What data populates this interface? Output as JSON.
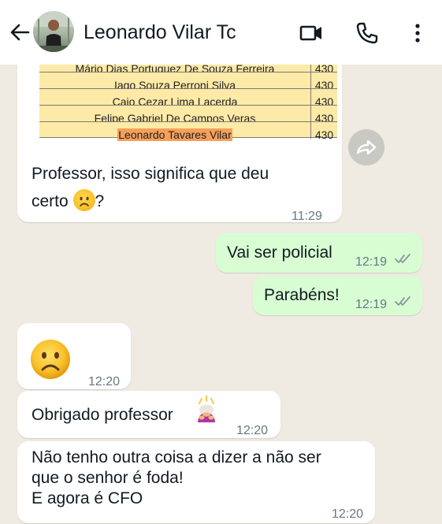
{
  "header": {
    "contact_name": "Leonardo Vilar Tc",
    "back_icon": "arrow-left-icon",
    "video_icon": "video-camera-icon",
    "phone_icon": "phone-icon",
    "menu_icon": "more-vertical-icon"
  },
  "colors": {
    "header_bg": "#ffffff",
    "chat_bg": "#efeae2",
    "incoming_bubble": "#ffffff",
    "outgoing_bubble": "#d9fdd3",
    "time_text": "#667781",
    "read_ticks": "#53bdeb",
    "doc_row_fill": "#fdeaa6",
    "doc_highlight": "#f5a05a"
  },
  "image_message": {
    "rows": [
      {
        "name": "Mário Dias Portuguez De Souza Ferreira",
        "score": "430"
      },
      {
        "name": "Iago Souza Perroni Silva",
        "score": "430"
      },
      {
        "name": "Caio Cezar Lima Lacerda",
        "score": "430"
      },
      {
        "name": "Felipe Gabriel De Campos Veras",
        "score": "430"
      },
      {
        "name": "Leonardo Tavares Vilar",
        "score": "430"
      }
    ],
    "caption_line1": "Professor, isso significa que deu",
    "caption_line2_pre": "certo",
    "caption_line2_post": "?",
    "time": "11:29",
    "forward_icon": "forward-icon"
  },
  "messages": [
    {
      "id": "m1",
      "text": "Vai ser policial",
      "time": "12:19"
    },
    {
      "id": "m2",
      "text": "Parabéns!",
      "time": "12:19"
    },
    {
      "id": "m3",
      "emoji": "frowning-face",
      "time": "12:20"
    },
    {
      "id": "m4",
      "text": "Obrigado professor",
      "emoji": "person-bowing",
      "time": "12:20"
    },
    {
      "id": "m5",
      "line1": "Não tenho outra coisa a dizer a não ser",
      "line2": "que o senhor é foda!",
      "line3": "E agora é CFO",
      "time": "12:20"
    }
  ]
}
